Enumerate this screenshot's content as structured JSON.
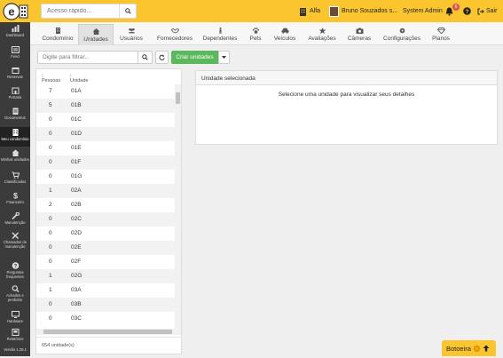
{
  "topbar": {
    "search_placeholder": "Acesso rápido...",
    "condo_name": "Alfa",
    "user_name": "Bruno Souzados s...",
    "role": "System Admin",
    "notifications_count": "6",
    "logout_label": "Sair"
  },
  "sidebar": {
    "items": [
      {
        "label": "Dashboard",
        "icon": "dashboard-icon"
      },
      {
        "label": "Feed",
        "icon": "feed-icon"
      },
      {
        "label": "Reservas",
        "icon": "calendar-icon"
      },
      {
        "label": "Portaria",
        "icon": "gatehouse-icon"
      },
      {
        "label": "Documentos",
        "icon": "document-icon"
      },
      {
        "label": "Meu condomínio",
        "icon": "building-icon"
      },
      {
        "label": "Minhas unidades",
        "icon": "home-icon"
      },
      {
        "label": "Classificados",
        "icon": "cart-icon"
      },
      {
        "label": "Financeiro",
        "icon": "dollar-icon"
      },
      {
        "label": "Manutenção",
        "icon": "wrench-icon"
      },
      {
        "label": "Chamados de manutenção",
        "icon": "tools-icon"
      },
      {
        "label": "Perguntas frequentes",
        "icon": "question-icon"
      },
      {
        "label": "Achados e perdidos",
        "icon": "search-icon"
      },
      {
        "label": "Hardware",
        "icon": "monitor-icon"
      },
      {
        "label": "Relatórios",
        "icon": "report-icon"
      },
      {
        "label": "Versão 1.28.1",
        "icon": "version-icon"
      }
    ]
  },
  "tabs": [
    {
      "label": "Condomínio",
      "icon": "building-icon",
      "active": false
    },
    {
      "label": "Unidades",
      "icon": "home-icon",
      "active": true
    },
    {
      "label": "Usuários",
      "icon": "users-icon",
      "active": false
    },
    {
      "label": "Fornecedores",
      "icon": "handshake-icon",
      "active": false
    },
    {
      "label": "Dependentes",
      "icon": "child-icon",
      "active": false
    },
    {
      "label": "Pets",
      "icon": "paw-icon",
      "active": false
    },
    {
      "label": "Veículos",
      "icon": "car-icon",
      "active": false
    },
    {
      "label": "Avaliações",
      "icon": "star-icon",
      "active": false
    },
    {
      "label": "Câmeras",
      "icon": "camera-icon",
      "active": false
    },
    {
      "label": "Configurações",
      "icon": "gear-icon",
      "active": false
    },
    {
      "label": "Planos",
      "icon": "diamond-icon",
      "active": false
    }
  ],
  "toolbar": {
    "filter_placeholder": "Digite para filtrar...",
    "create_label": "Criar unidades"
  },
  "list": {
    "columns": [
      "Pessoas",
      "Unidade"
    ],
    "rows": [
      {
        "pessoas": "7",
        "unidade": "01A"
      },
      {
        "pessoas": "5",
        "unidade": "01B"
      },
      {
        "pessoas": "0",
        "unidade": "01C"
      },
      {
        "pessoas": "0",
        "unidade": "01D"
      },
      {
        "pessoas": "0",
        "unidade": "01E"
      },
      {
        "pessoas": "0",
        "unidade": "01F"
      },
      {
        "pessoas": "0",
        "unidade": "01G"
      },
      {
        "pessoas": "1",
        "unidade": "02A"
      },
      {
        "pessoas": "2",
        "unidade": "02B"
      },
      {
        "pessoas": "0",
        "unidade": "02C"
      },
      {
        "pessoas": "0",
        "unidade": "02D"
      },
      {
        "pessoas": "0",
        "unidade": "02E"
      },
      {
        "pessoas": "0",
        "unidade": "02F"
      },
      {
        "pessoas": "1",
        "unidade": "02G"
      },
      {
        "pessoas": "1",
        "unidade": "03A"
      },
      {
        "pessoas": "0",
        "unidade": "03B"
      },
      {
        "pessoas": "0",
        "unidade": "03C"
      }
    ],
    "count_label": "654 unidade(s)"
  },
  "detail": {
    "title": "Unidade selecionada",
    "message": "Selecione uma unidade para visualizar seus detalhes"
  },
  "botoeira": {
    "label": "Botoeira"
  },
  "colors": {
    "brand": "#fbc52f",
    "sidebar": "#3b3b3b",
    "success": "#5cb85c",
    "badge": "#d9534f"
  }
}
